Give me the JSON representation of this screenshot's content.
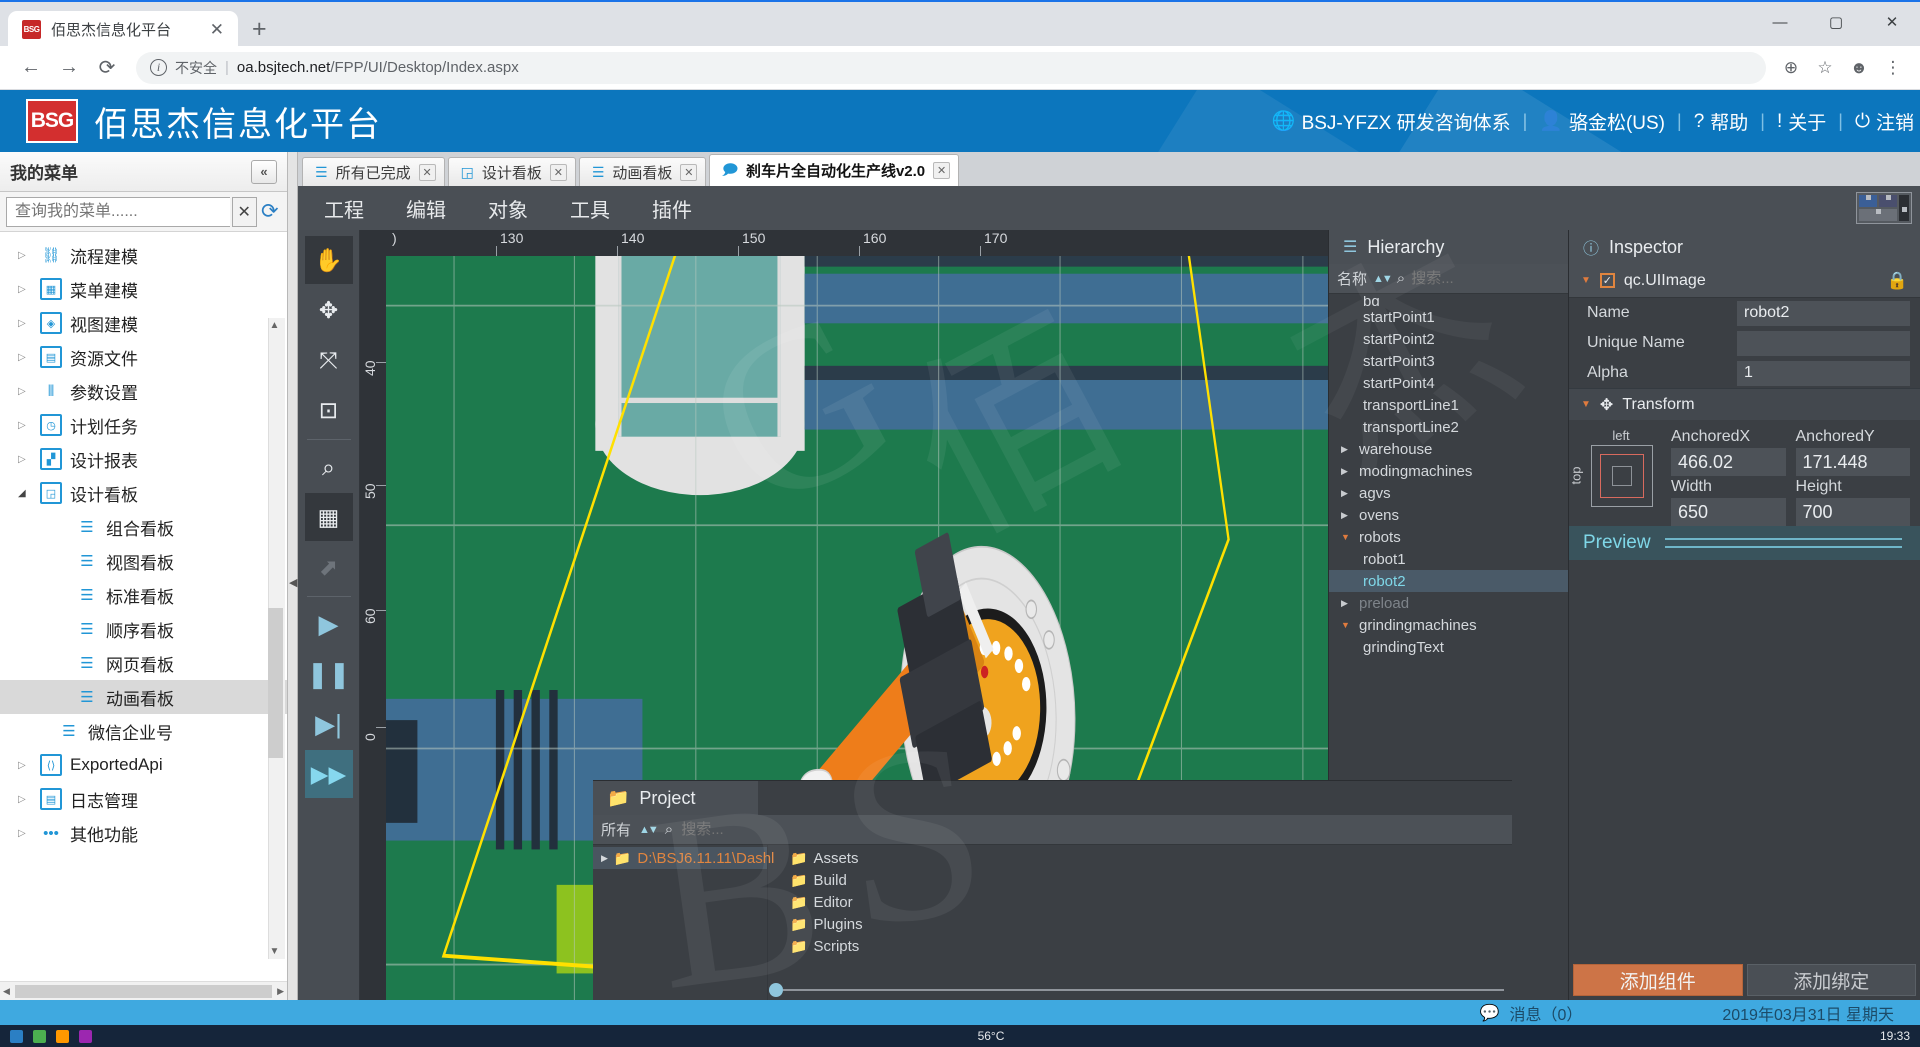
{
  "browser": {
    "tab_title": "佰思杰信息化平台",
    "favicon_text": "BSG",
    "close_tab": "✕",
    "new_tab": "+",
    "window_buttons": [
      "—",
      "▢",
      "✕"
    ],
    "back": "←",
    "forward": "→",
    "reload": "⟳",
    "security_label": "不安全",
    "url_domain": "oa.bsjtech.net",
    "url_path": "/FPP/UI/Desktop/Index.aspx",
    "zoom_icon": "⊕",
    "star_icon": "☆",
    "profile_icon": "☻",
    "menu_icon": "⋮"
  },
  "app_header": {
    "logo": "BSG",
    "product_name": "佰思杰信息化平台",
    "org": "BSJ-YFZX 研发咨询体系",
    "user": "骆金松(US)",
    "help": "帮助",
    "about": "关于",
    "logout": "注销",
    "accent": "#0c76bd"
  },
  "left_menu": {
    "title": "我的菜单",
    "collapse": "«",
    "search_placeholder": "查询我的菜单......",
    "search_value": "",
    "clear": "✕",
    "refresh_icon": "refresh-icon",
    "items": [
      {
        "label": "流程建模",
        "level": 1,
        "arrow": "▷",
        "icon": "flow-icon"
      },
      {
        "label": "菜单建模",
        "level": 1,
        "arrow": "▷",
        "icon": "grid-icon"
      },
      {
        "label": "视图建模",
        "level": 1,
        "arrow": "▷",
        "icon": "cube-icon"
      },
      {
        "label": "资源文件",
        "level": 1,
        "arrow": "▷",
        "icon": "document-icon"
      },
      {
        "label": "参数设置",
        "level": 1,
        "arrow": "▷",
        "icon": "sliders-icon"
      },
      {
        "label": "计划任务",
        "level": 1,
        "arrow": "▷",
        "icon": "clock-icon"
      },
      {
        "label": "设计报表",
        "level": 1,
        "arrow": "▷",
        "icon": "chart-icon"
      },
      {
        "label": "设计看板",
        "level": 1,
        "arrow": "◢",
        "icon": "board-icon",
        "expanded": true
      },
      {
        "label": "组合看板",
        "level": 2,
        "icon": "list-icon"
      },
      {
        "label": "视图看板",
        "level": 2,
        "icon": "list-icon"
      },
      {
        "label": "标准看板",
        "level": 2,
        "icon": "list-icon"
      },
      {
        "label": "顺序看板",
        "level": 2,
        "icon": "list-icon"
      },
      {
        "label": "网页看板",
        "level": 2,
        "icon": "list-icon"
      },
      {
        "label": "动画看板",
        "level": 2,
        "icon": "list-icon",
        "selected": true
      },
      {
        "label": "微信企业号",
        "level": 2,
        "icon": "list-icon",
        "noarrow": true
      },
      {
        "label": "ExportedApi",
        "level": 1,
        "arrow": "▷",
        "icon": "code-icon"
      },
      {
        "label": "日志管理",
        "level": 1,
        "arrow": "▷",
        "icon": "log-icon"
      },
      {
        "label": "其他功能",
        "level": 1,
        "arrow": "▷",
        "icon": "dots-icon"
      }
    ]
  },
  "editor_tabs": [
    {
      "label": "所有已完成",
      "icon": "list-icon",
      "close": "✕",
      "active": false
    },
    {
      "label": "设计看板",
      "icon": "board-icon",
      "close": "✕",
      "active": false
    },
    {
      "label": "动画看板",
      "icon": "list-icon",
      "close": "✕",
      "active": false
    },
    {
      "label": "刹车片全自动化生产线v2.0",
      "icon": "chat-icon",
      "close": "✕",
      "active": true
    }
  ],
  "editor_menu": [
    "工程",
    "编辑",
    "对象",
    "工具",
    "插件"
  ],
  "vtools": [
    {
      "name": "hand-tool",
      "glyph": "✋",
      "active": true
    },
    {
      "name": "move-tool",
      "glyph": "✥",
      "active": false
    },
    {
      "name": "scale-tool",
      "glyph": "⤧",
      "active": false
    },
    {
      "name": "rect-tool",
      "glyph": "⊡",
      "active": false
    },
    {
      "name": "zoom-tool",
      "glyph": "⌕",
      "active": false
    },
    {
      "name": "grid-tool",
      "glyph": "▦",
      "active": true
    },
    {
      "name": "select-tool",
      "glyph": "⬈",
      "active": false,
      "dim": true
    },
    {
      "name": "play-button",
      "glyph": "▶",
      "play": true
    },
    {
      "name": "pause-button",
      "glyph": "❚❚",
      "play": true
    },
    {
      "name": "step-button",
      "glyph": "▶|",
      "play": true
    },
    {
      "name": "fast-forward-button",
      "glyph": "▶▶",
      "ff": true
    }
  ],
  "canvas": {
    "h_ticks": [
      "130",
      "140",
      "150",
      "160",
      "170"
    ],
    "h_tick_prefix": ")",
    "v_ticks": [
      "40",
      "50",
      "60",
      "0"
    ],
    "background_color": "#1d7a4d"
  },
  "hierarchy": {
    "panel_title": "Hierarchy",
    "sort_label": "名称",
    "search_placeholder": "搜索...",
    "search_value": "",
    "items": [
      {
        "label": "bg",
        "indent": 1,
        "clipped": true
      },
      {
        "label": "startPoint1",
        "indent": 1
      },
      {
        "label": "startPoint2",
        "indent": 1
      },
      {
        "label": "startPoint3",
        "indent": 1
      },
      {
        "label": "startPoint4",
        "indent": 1
      },
      {
        "label": "transportLine1",
        "indent": 1
      },
      {
        "label": "transportLine2",
        "indent": 1
      },
      {
        "label": "warehouse",
        "indent": 0,
        "arrow": "▶"
      },
      {
        "label": "modingmachines",
        "indent": 0,
        "arrow": "▶"
      },
      {
        "label": "agvs",
        "indent": 0,
        "arrow": "▶"
      },
      {
        "label": "ovens",
        "indent": 0,
        "arrow": "▶"
      },
      {
        "label": "robots",
        "indent": 0,
        "arrow": "▼",
        "open": true
      },
      {
        "label": "robot1",
        "indent": 1
      },
      {
        "label": "robot2",
        "indent": 1,
        "selected": true
      },
      {
        "label": "preload",
        "indent": 0,
        "arrow": "▶",
        "dim": true
      },
      {
        "label": "grindingmachines",
        "indent": 0,
        "arrow": "▼",
        "open": true
      },
      {
        "label": "grindingText",
        "indent": 1
      }
    ]
  },
  "inspector": {
    "panel_title": "Inspector",
    "component_caret": "▼",
    "component_checked": "✓",
    "component_name": "qc.UIImage",
    "lock_icon": "lock-icon",
    "fields": [
      {
        "label": "Name",
        "value": "robot2"
      },
      {
        "label": "Unique Name",
        "value": ""
      },
      {
        "label": "Alpha",
        "value": "1"
      }
    ],
    "transform": {
      "section_title": "Transform",
      "caret": "▼",
      "anchor_top_label": "left",
      "anchor_left_label": "top",
      "anchored_x_label": "AnchoredX",
      "anchored_x": "466.02",
      "anchored_y_label": "AnchoredY",
      "anchored_y": "171.448",
      "width_label": "Width",
      "width": "650",
      "height_label": "Height",
      "height": "700"
    },
    "preview_label": "Preview",
    "add_component": "添加组件",
    "add_binding": "添加绑定",
    "accent_orange": "#cd7447"
  },
  "project": {
    "panel_title": "Project",
    "filter_label": "所有",
    "search_placeholder": "搜索...",
    "search_value": "",
    "root_path": "D:\\BSJ6.11.11\\Dashl",
    "folders": [
      "Assets",
      "Build",
      "Editor",
      "Plugins",
      "Scripts"
    ]
  },
  "status_bar": {
    "message_icon": "message-icon",
    "message_label": "消息（0）",
    "date": "2019年03月31日 星期天"
  },
  "taskbar": {
    "temperature": "56°C",
    "time": "19:33"
  },
  "watermarks": [
    "B",
    "S",
    "G",
    "佰",
    "思",
    "杰"
  ]
}
